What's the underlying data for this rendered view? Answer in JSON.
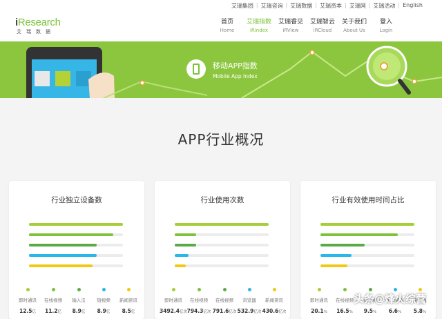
{
  "toplinks": [
    "艾瑞集团",
    "艾瑞咨询",
    "艾瑞数据",
    "艾瑞资本",
    "艾瑞网",
    "艾瑞活动",
    "English"
  ],
  "logo": {
    "brand_i": "i",
    "brand_rest": "Research",
    "sub": "艾瑞数据"
  },
  "nav": [
    {
      "cn": "首页",
      "en": "Home"
    },
    {
      "cn": "艾瑞指数",
      "en": "iRindex"
    },
    {
      "cn": "艾瑞睿见",
      "en": "iRView"
    },
    {
      "cn": "艾瑞智云",
      "en": "iRCloud"
    },
    {
      "cn": "关于我们",
      "en": "About Us"
    },
    {
      "cn": "登入",
      "en": "Login"
    }
  ],
  "banner": {
    "title": "移动APP指数",
    "subtitle": "Mobile App Index"
  },
  "heading": "APP行业概况",
  "colors": [
    "#a6ce39",
    "#7cc23a",
    "#5aab46",
    "#29b6e8",
    "#f2c811"
  ],
  "cards": [
    {
      "title": "行业独立设备数",
      "bars": [
        1.0,
        0.9,
        0.72,
        0.72,
        0.68
      ],
      "items": [
        {
          "label": "即时通讯",
          "value": "12.5",
          "unit": "亿"
        },
        {
          "label": "在线视频",
          "value": "11.2",
          "unit": "亿"
        },
        {
          "label": "输入法",
          "value": "8.9",
          "unit": "亿"
        },
        {
          "label": "短视频",
          "value": "8.9",
          "unit": "亿"
        },
        {
          "label": "新闻资讯",
          "value": "8.5",
          "unit": "亿"
        }
      ]
    },
    {
      "title": "行业使用次数",
      "bars": [
        1.0,
        0.23,
        0.23,
        0.15,
        0.12
      ],
      "items": [
        {
          "label": "即时通讯",
          "value": "3492.4",
          "unit": "亿次"
        },
        {
          "label": "在线视频",
          "value": "794.3",
          "unit": "亿次"
        },
        {
          "label": "在线视频",
          "value": "791.6",
          "unit": "亿次"
        },
        {
          "label": "浏览器",
          "value": "532.9",
          "unit": "亿次"
        },
        {
          "label": "新闻资讯",
          "value": "430.6",
          "unit": "亿次"
        }
      ]
    },
    {
      "title": "行业有效使用时间占比",
      "bars": [
        1.0,
        0.82,
        0.47,
        0.33,
        0.29
      ],
      "items": [
        {
          "label": "即时通讯",
          "value": "20.1",
          "unit": "%"
        },
        {
          "label": "在线视频",
          "value": "16.5",
          "unit": "%"
        },
        {
          "label": "短视频",
          "value": "9.5",
          "unit": "%"
        },
        {
          "label": "新闻资讯",
          "value": "6.6",
          "unit": "%"
        },
        {
          "label": "浏览器",
          "value": "5.8",
          "unit": "%"
        }
      ]
    }
  ],
  "watermark": "头条@烽火综营"
}
